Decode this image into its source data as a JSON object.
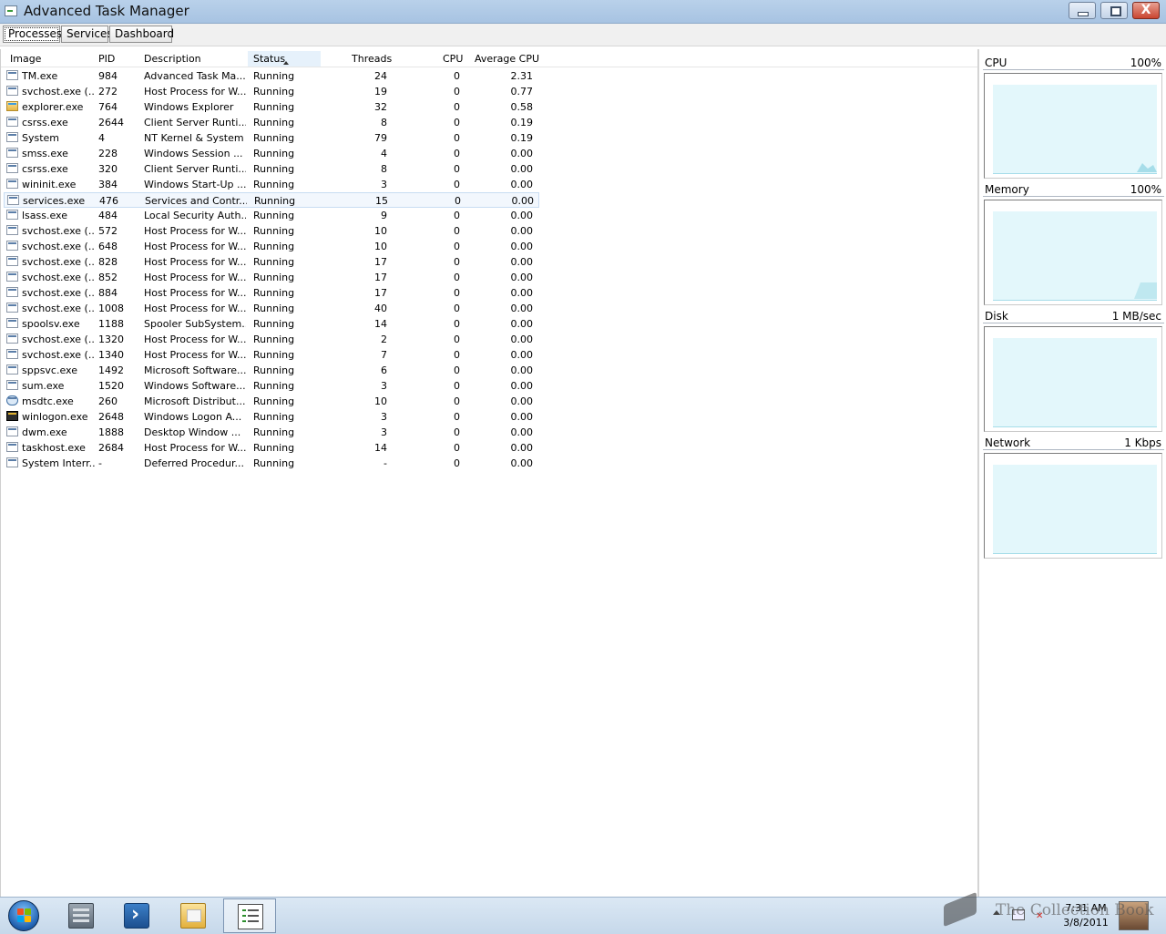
{
  "window": {
    "title": "Advanced Task Manager",
    "close_glyph": "X"
  },
  "tabs": [
    "Processes",
    "Services",
    "Dashboard"
  ],
  "active_tab": "Processes",
  "table": {
    "columns": [
      "Image",
      "PID",
      "Description",
      "Status",
      "Threads",
      "CPU",
      "Average CPU"
    ],
    "sorted_by": "Status",
    "selected_row": 8,
    "rows": [
      {
        "image": "TM.exe",
        "pid": "984",
        "desc": "Advanced Task Ma...",
        "status": "Running",
        "threads": "24",
        "cpu": "0",
        "avg": "2.31",
        "icon": "tm-app-icon"
      },
      {
        "image": "svchost.exe (...",
        "pid": "272",
        "desc": "Host Process for W...",
        "status": "Running",
        "threads": "19",
        "cpu": "0",
        "avg": "0.77",
        "icon": "process-icon"
      },
      {
        "image": "explorer.exe",
        "pid": "764",
        "desc": "Windows Explorer",
        "status": "Running",
        "threads": "32",
        "cpu": "0",
        "avg": "0.58",
        "icon": "folder-icon"
      },
      {
        "image": "csrss.exe",
        "pid": "2644",
        "desc": "Client Server Runti...",
        "status": "Running",
        "threads": "8",
        "cpu": "0",
        "avg": "0.19",
        "icon": "process-icon"
      },
      {
        "image": "System",
        "pid": "4",
        "desc": "NT Kernel & System",
        "status": "Running",
        "threads": "79",
        "cpu": "0",
        "avg": "0.19",
        "icon": "process-icon"
      },
      {
        "image": "smss.exe",
        "pid": "228",
        "desc": "Windows Session ...",
        "status": "Running",
        "threads": "4",
        "cpu": "0",
        "avg": "0.00",
        "icon": "process-icon"
      },
      {
        "image": "csrss.exe",
        "pid": "320",
        "desc": "Client Server Runti...",
        "status": "Running",
        "threads": "8",
        "cpu": "0",
        "avg": "0.00",
        "icon": "process-icon"
      },
      {
        "image": "wininit.exe",
        "pid": "384",
        "desc": "Windows Start-Up ...",
        "status": "Running",
        "threads": "3",
        "cpu": "0",
        "avg": "0.00",
        "icon": "process-icon"
      },
      {
        "image": "services.exe",
        "pid": "476",
        "desc": "Services and Contr...",
        "status": "Running",
        "threads": "15",
        "cpu": "0",
        "avg": "0.00",
        "icon": "process-icon"
      },
      {
        "image": "lsass.exe",
        "pid": "484",
        "desc": "Local Security Auth...",
        "status": "Running",
        "threads": "9",
        "cpu": "0",
        "avg": "0.00",
        "icon": "process-icon"
      },
      {
        "image": "svchost.exe (...",
        "pid": "572",
        "desc": "Host Process for W...",
        "status": "Running",
        "threads": "10",
        "cpu": "0",
        "avg": "0.00",
        "icon": "process-icon"
      },
      {
        "image": "svchost.exe (...",
        "pid": "648",
        "desc": "Host Process for W...",
        "status": "Running",
        "threads": "10",
        "cpu": "0",
        "avg": "0.00",
        "icon": "process-icon"
      },
      {
        "image": "svchost.exe (...",
        "pid": "828",
        "desc": "Host Process for W...",
        "status": "Running",
        "threads": "17",
        "cpu": "0",
        "avg": "0.00",
        "icon": "process-icon"
      },
      {
        "image": "svchost.exe (...",
        "pid": "852",
        "desc": "Host Process for W...",
        "status": "Running",
        "threads": "17",
        "cpu": "0",
        "avg": "0.00",
        "icon": "process-icon"
      },
      {
        "image": "svchost.exe (...",
        "pid": "884",
        "desc": "Host Process for W...",
        "status": "Running",
        "threads": "17",
        "cpu": "0",
        "avg": "0.00",
        "icon": "process-icon"
      },
      {
        "image": "svchost.exe (...",
        "pid": "1008",
        "desc": "Host Process for W...",
        "status": "Running",
        "threads": "40",
        "cpu": "0",
        "avg": "0.00",
        "icon": "process-icon"
      },
      {
        "image": "spoolsv.exe",
        "pid": "1188",
        "desc": "Spooler SubSystem...",
        "status": "Running",
        "threads": "14",
        "cpu": "0",
        "avg": "0.00",
        "icon": "process-icon"
      },
      {
        "image": "svchost.exe (...",
        "pid": "1320",
        "desc": "Host Process for W...",
        "status": "Running",
        "threads": "2",
        "cpu": "0",
        "avg": "0.00",
        "icon": "process-icon"
      },
      {
        "image": "svchost.exe (...",
        "pid": "1340",
        "desc": "Host Process for W...",
        "status": "Running",
        "threads": "7",
        "cpu": "0",
        "avg": "0.00",
        "icon": "process-icon"
      },
      {
        "image": "sppsvc.exe",
        "pid": "1492",
        "desc": "Microsoft Software...",
        "status": "Running",
        "threads": "6",
        "cpu": "0",
        "avg": "0.00",
        "icon": "process-icon"
      },
      {
        "image": "sum.exe",
        "pid": "1520",
        "desc": "Windows Software...",
        "status": "Running",
        "threads": "3",
        "cpu": "0",
        "avg": "0.00",
        "icon": "process-icon"
      },
      {
        "image": "msdtc.exe",
        "pid": "260",
        "desc": "Microsoft Distribut...",
        "status": "Running",
        "threads": "10",
        "cpu": "0",
        "avg": "0.00",
        "icon": "network-icon"
      },
      {
        "image": "winlogon.exe",
        "pid": "2648",
        "desc": "Windows Logon A...",
        "status": "Running",
        "threads": "3",
        "cpu": "0",
        "avg": "0.00",
        "icon": "lock-icon"
      },
      {
        "image": "dwm.exe",
        "pid": "1888",
        "desc": "Desktop Window ...",
        "status": "Running",
        "threads": "3",
        "cpu": "0",
        "avg": "0.00",
        "icon": "process-icon"
      },
      {
        "image": "taskhost.exe",
        "pid": "2684",
        "desc": "Host Process for W...",
        "status": "Running",
        "threads": "14",
        "cpu": "0",
        "avg": "0.00",
        "icon": "process-icon"
      },
      {
        "image": "System Interr...",
        "pid": "-",
        "desc": "Deferred Procedur...",
        "status": "Running",
        "threads": "-",
        "cpu": "0",
        "avg": "0.00",
        "icon": "process-icon"
      }
    ]
  },
  "dashboard": {
    "graphs": [
      {
        "name": "CPU",
        "value": "100%"
      },
      {
        "name": "Memory",
        "value": "100%"
      },
      {
        "name": "Disk",
        "value": "1 MB/sec"
      },
      {
        "name": "Network",
        "value": "1 Kbps"
      }
    ]
  },
  "taskbar": {
    "pinned": [
      "server-manager-icon",
      "powershell-icon",
      "explorer-folder-icon",
      "task-manager-icon"
    ],
    "active": "task-manager-icon",
    "clock_time": "7:31 AM",
    "clock_date": "3/8/2011"
  },
  "watermark": {
    "text": "The Collection Book"
  },
  "colors": {
    "graph_fill": "#e3f7fb",
    "graph_line": "#a6dde9",
    "titlebar": "#b9d1ea",
    "selected_row": "#f2f7fd"
  }
}
